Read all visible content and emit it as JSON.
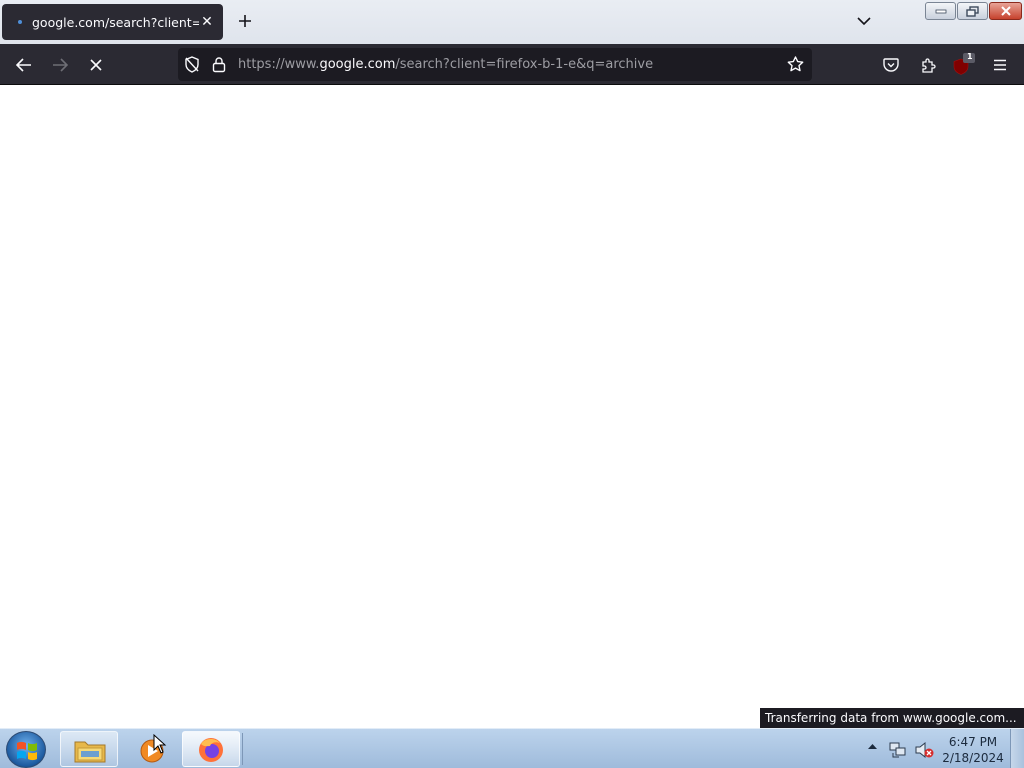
{
  "browser": {
    "tab": {
      "title": "google.com/search?client=firefox",
      "close": "✕"
    },
    "new_tab": "+",
    "url": {
      "prefix": "https://www.",
      "host": "google.com",
      "path": "/search?client=firefox-b-1-e&q=archive"
    },
    "extension_badge": "1",
    "status_text": "Transferring data from www.google.com..."
  },
  "taskbar": {
    "clock_time": "6:47 PM",
    "clock_date": "2/18/2024"
  }
}
